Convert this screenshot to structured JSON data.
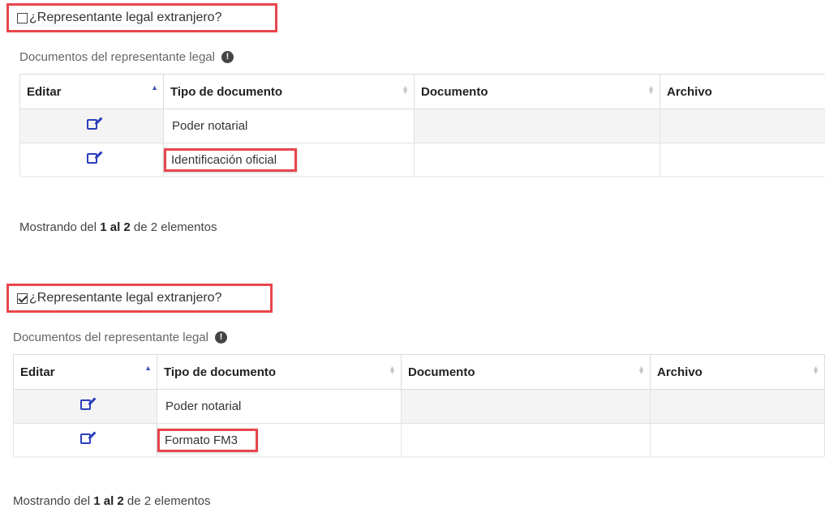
{
  "sections": [
    {
      "checkbox_label": "¿Representante legal extranjero?",
      "checked": false,
      "subtitle": "Documentos del representante legal",
      "columns": [
        "Editar",
        "Tipo de documento",
        "Documento",
        "Archivo"
      ],
      "rows": [
        {
          "tipo": "Poder notarial",
          "documento": "",
          "archivo": ""
        },
        {
          "tipo": "Identificación oficial",
          "documento": "",
          "archivo": ""
        }
      ],
      "footer": {
        "prefix": "Mostrando del ",
        "range": "1 al 2",
        "suffix": " de 2 elementos"
      }
    },
    {
      "checkbox_label": "¿Representante legal extranjero?",
      "checked": true,
      "subtitle": "Documentos del representante legal",
      "columns": [
        "Editar",
        "Tipo de documento",
        "Documento",
        "Archivo"
      ],
      "rows": [
        {
          "tipo": "Poder notarial",
          "documento": "",
          "archivo": ""
        },
        {
          "tipo": "Formato FM3",
          "documento": "",
          "archivo": ""
        }
      ],
      "footer": {
        "prefix": "Mostrando del ",
        "range": "1 al 2",
        "suffix": " de 2 elementos"
      }
    }
  ],
  "icons": {
    "info": "info-circle-icon",
    "edit": "edit-square-icon",
    "scroll_left": "chevron-left-icon",
    "scroll_right": "chevron-right-icon"
  },
  "colors": {
    "highlight": "#e8464c",
    "accent": "#2b3fbc"
  }
}
